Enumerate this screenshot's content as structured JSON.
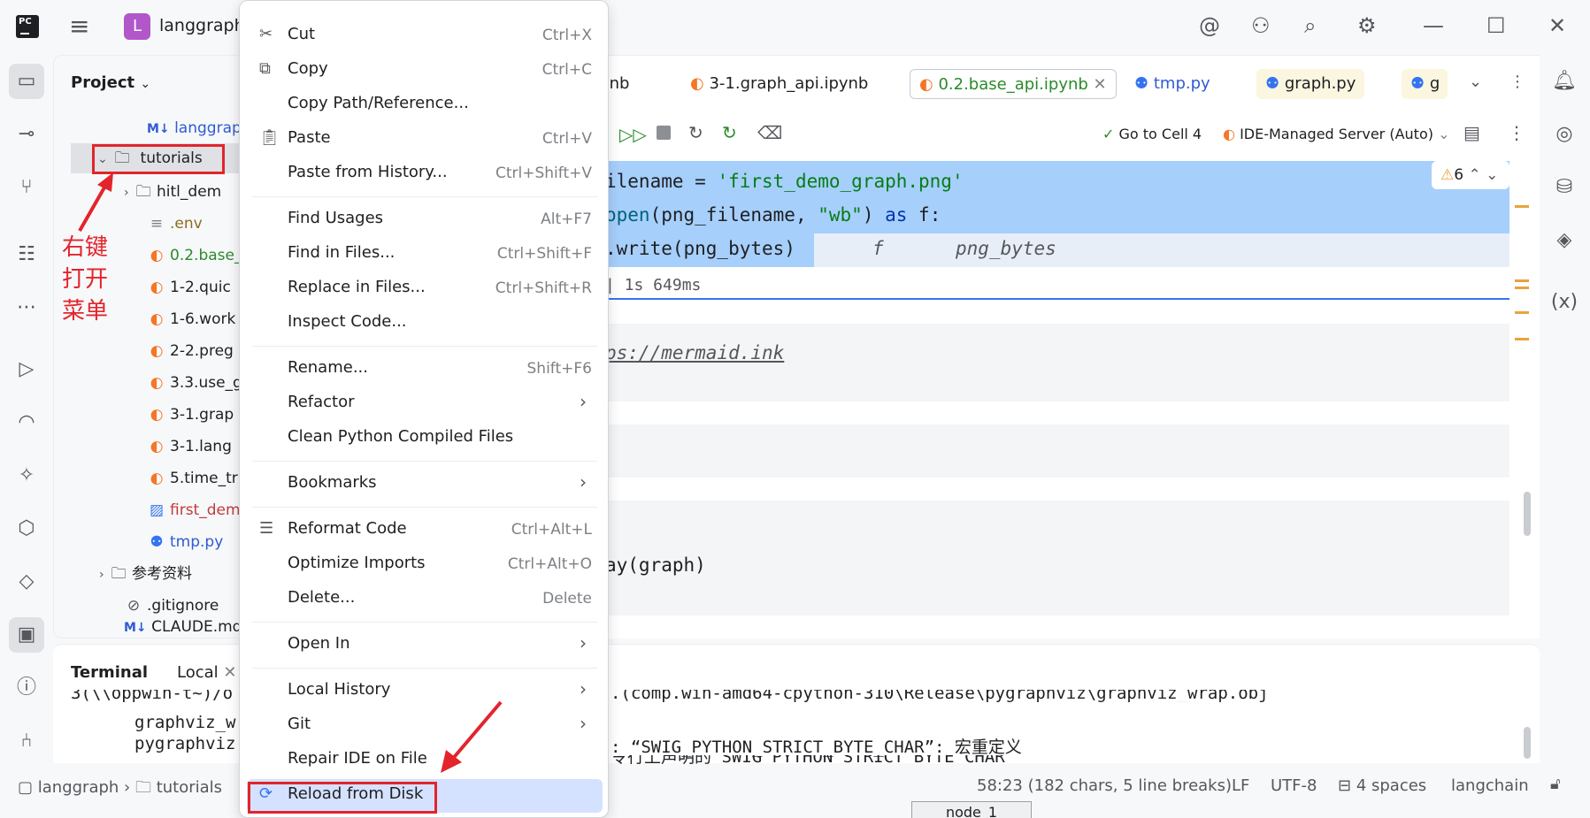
{
  "titlebar": {
    "project_letter": "L",
    "project_name": "langgraph"
  },
  "project_panel": {
    "title": "Project",
    "tree": [
      {
        "label": "langgraph",
        "icon": "markdown-icon",
        "color": "#2f5bd3"
      },
      {
        "label": "tutorials",
        "icon": "folder-icon"
      },
      {
        "label": "hitl_dem",
        "icon": "folder-icon"
      },
      {
        "label": ".env",
        "icon": "file-lines-icon",
        "color": "#8a6d1f"
      },
      {
        "label": "0.2.base_",
        "icon": "jupyter-icon",
        "color": "#2a8a2a"
      },
      {
        "label": "1-2.quic",
        "icon": "jupyter-icon"
      },
      {
        "label": "1-6.work",
        "icon": "jupyter-icon"
      },
      {
        "label": "2-2.preg",
        "icon": "jupyter-icon"
      },
      {
        "label": "3.3.use_g",
        "icon": "jupyter-icon"
      },
      {
        "label": "3-1.grap",
        "icon": "jupyter-icon"
      },
      {
        "label": "3-1.lang",
        "icon": "jupyter-icon"
      },
      {
        "label": "5.time_tr",
        "icon": "jupyter-icon"
      },
      {
        "label": "first_dem",
        "icon": "image-icon",
        "color": "#c13b3b"
      },
      {
        "label": "tmp.py",
        "icon": "python-icon",
        "color": "#2f5bd3"
      },
      {
        "label": "参考资料",
        "icon": "folder-icon"
      },
      {
        "label": ".gitignore",
        "icon": "ignore-icon"
      },
      {
        "label": "CLAUDE.md",
        "icon": "markdown-icon"
      }
    ]
  },
  "annotation": {
    "line1": "右键",
    "line2": "打开",
    "line3": "菜单"
  },
  "tabs": [
    {
      "label": "ynb"
    },
    {
      "label": "3-1.graph_api.ipynb"
    },
    {
      "label": "0.2.base_api.ipynb",
      "active": true
    },
    {
      "label": "tmp.py"
    },
    {
      "label": "graph.py"
    },
    {
      "label": "g"
    }
  ],
  "editor_toolbar": {
    "goto_cell": "Go to Cell 4",
    "server": "IDE-Managed Server (Auto)",
    "warnings": "6"
  },
  "code": {
    "line1_a": "ilename = ",
    "line1_b": "'first_demo_graph.png'",
    "line2_a": "open",
    "line2_b": "(png_filename, ",
    "line2_c": "\"wb\"",
    "line2_d": ") ",
    "line2_e": "as",
    "line2_f": " f:",
    "line3": ".write(png_bytes)",
    "hint_f": "f",
    "hint_bytes": "png_bytes",
    "exec_time": "| 1s 649ms",
    "url": "ps://mermaid.ink",
    "call": "ay(graph)"
  },
  "terminal": {
    "title": "Terminal",
    "tab_local": "Local",
    "line0": "3(\\\\oppwin-t~)/o",
    "line0_r": ".(comp.win-amd64-cpython-310\\Release\\pygraphviz\\graphviz_wrap.obj",
    "line1": "graphviz_w",
    "line1_r": ": “SWIG_PYTHON_STRICT_BYTE_CHAR”: 宏重定义",
    "line2": "pygraphviz",
    "line2_r": "令行上声明的“SWIG_PYTHON_STRICT_BYTE_CHAR”"
  },
  "statusbar": {
    "crumb1": "langgraph",
    "crumb2": "tutorials",
    "position": "58:23 (182 chars, 5 line breaks)",
    "line_sep": "LF",
    "encoding": "UTF-8",
    "indent": "4 spaces",
    "interpreter": "langchain"
  },
  "bottom_peek": "node_1",
  "context_menu": {
    "items": [
      {
        "label": "Cut",
        "shortcut": "Ctrl+X",
        "icon": "scissors-icon"
      },
      {
        "label": "Copy",
        "shortcut": "Ctrl+C",
        "icon": "copy-icon"
      },
      {
        "label": "Copy Path/Reference...",
        "shortcut": ""
      },
      {
        "label": "Paste",
        "shortcut": "Ctrl+V",
        "icon": "paste-icon"
      },
      {
        "label": "Paste from History...",
        "shortcut": "Ctrl+Shift+V"
      },
      {
        "label": "Find Usages",
        "shortcut": "Alt+F7"
      },
      {
        "label": "Find in Files...",
        "shortcut": "Ctrl+Shift+F"
      },
      {
        "label": "Replace in Files...",
        "shortcut": "Ctrl+Shift+R"
      },
      {
        "label": "Inspect Code...",
        "shortcut": ""
      },
      {
        "label": "Rename...",
        "shortcut": "Shift+F6"
      },
      {
        "label": "Refactor",
        "shortcut": ""
      },
      {
        "label": "Clean Python Compiled Files",
        "shortcut": ""
      },
      {
        "label": "Bookmarks",
        "shortcut": ""
      },
      {
        "label": "Reformat Code",
        "shortcut": "Ctrl+Alt+L",
        "icon": "reformat-icon"
      },
      {
        "label": "Optimize Imports",
        "shortcut": "Ctrl+Alt+O"
      },
      {
        "label": "Delete...",
        "shortcut": "Delete"
      },
      {
        "label": "Open In",
        "shortcut": ""
      },
      {
        "label": "Local History",
        "shortcut": ""
      },
      {
        "label": "Git",
        "shortcut": ""
      },
      {
        "label": "Repair IDE on File",
        "shortcut": ""
      },
      {
        "label": "Reload from Disk",
        "shortcut": "",
        "icon": "reload-icon"
      }
    ]
  },
  "colors": {
    "accent": "#3574f0",
    "highlight": "#a6cffb",
    "annotation": "#e3242b"
  }
}
